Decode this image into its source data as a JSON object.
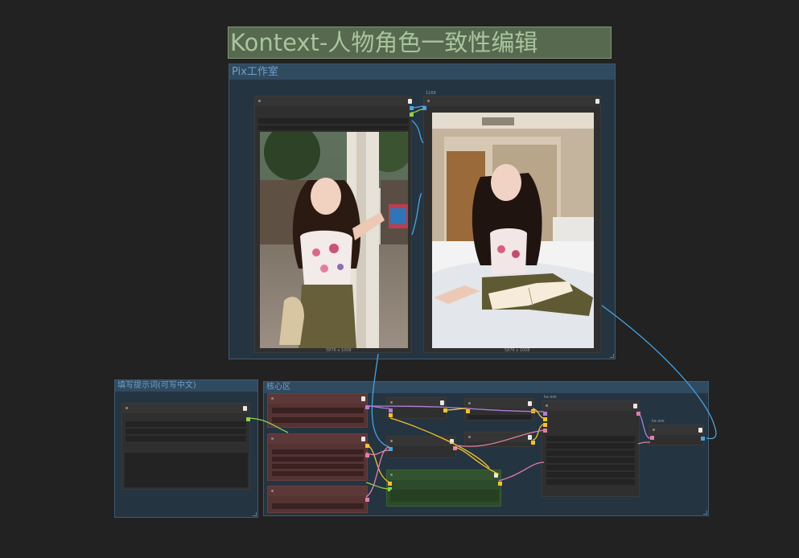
{
  "canvas": {
    "title": "Kontext-人物角色一致性编辑",
    "groups": {
      "workshop": "Pix工作室",
      "prompt": "填写提示词(可写中文)",
      "core": "核心区"
    }
  },
  "nodes": {
    "preview_left": {
      "caption": "5876 x 1008"
    },
    "preview_right": {
      "title": "1169",
      "caption": "5876 x 1008"
    },
    "core_node_a": {
      "title": "ka ere"
    },
    "core_node_b": {
      "title": "ka ere"
    }
  },
  "images": {
    "left": {
      "description_icon": "photo-street-portrait",
      "scene": "street"
    },
    "right": {
      "description_icon": "photo-bed-reading",
      "scene": "bedroom"
    }
  },
  "colors": {
    "canvas_bg": "#222222",
    "group_bg": "#253441",
    "title_bg": "#57694f",
    "link_blue": "#4aa3e0",
    "link_yellow": "#f2c230",
    "link_pink": "#e27fa7",
    "link_green": "#8fd14f",
    "link_purple": "#b07fd6"
  }
}
